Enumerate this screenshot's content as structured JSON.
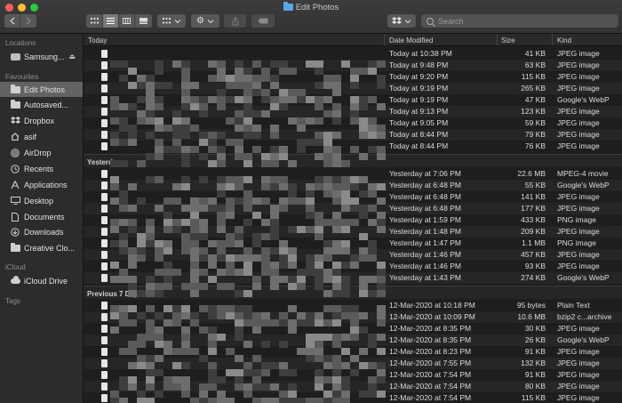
{
  "window": {
    "title": "Edit Photos"
  },
  "search": {
    "placeholder": "Search"
  },
  "sidebar": {
    "locations_title": "Locations",
    "locations": [
      {
        "label": "Samsung...",
        "icon": "disk-icon"
      }
    ],
    "favourites_title": "Favourites",
    "favourites": [
      {
        "label": "Edit Photos",
        "icon": "folder-icon",
        "selected": true
      },
      {
        "label": "Autosaved...",
        "icon": "folder-icon"
      },
      {
        "label": "Dropbox",
        "icon": "dropbox-icon"
      },
      {
        "label": "asif",
        "icon": "home-icon"
      },
      {
        "label": "AirDrop",
        "icon": "airdrop-icon"
      },
      {
        "label": "Recents",
        "icon": "clock-icon"
      },
      {
        "label": "Applications",
        "icon": "applications-icon"
      },
      {
        "label": "Desktop",
        "icon": "desktop-icon"
      },
      {
        "label": "Documents",
        "icon": "document-icon"
      },
      {
        "label": "Downloads",
        "icon": "download-icon"
      },
      {
        "label": "Creative Clo...",
        "icon": "folder-icon"
      }
    ],
    "icloud_title": "iCloud",
    "icloud": [
      {
        "label": "iCloud Drive",
        "icon": "cloud-icon"
      }
    ],
    "tags_title": "Tags"
  },
  "columns": {
    "name": "Today",
    "date": "Date Modified",
    "size": "Size",
    "kind": "Kind"
  },
  "groups": [
    {
      "title": "Today",
      "rows": [
        {
          "date": "Today at 10:38 PM",
          "size": "41 KB",
          "kind": "JPEG image"
        },
        {
          "date": "Today at 9:48 PM",
          "size": "63 KB",
          "kind": "JPEG image"
        },
        {
          "date": "Today at 9:20 PM",
          "size": "115 KB",
          "kind": "JPEG image"
        },
        {
          "date": "Today at 9:19 PM",
          "size": "265 KB",
          "kind": "JPEG image"
        },
        {
          "date": "Today at 9:19 PM",
          "size": "47 KB",
          "kind": "Google's WebP"
        },
        {
          "date": "Today at 9:13 PM",
          "size": "123 KB",
          "kind": "JPEG image"
        },
        {
          "date": "Today at 9:05 PM",
          "size": "59 KB",
          "kind": "JPEG image"
        },
        {
          "date": "Today at 8:44 PM",
          "size": "79 KB",
          "kind": "JPEG image"
        },
        {
          "date": "Today at 8:44 PM",
          "size": "76 KB",
          "kind": "JPEG image"
        }
      ]
    },
    {
      "title": "Yesterday",
      "rows": [
        {
          "date": "Yesterday at 7:06 PM",
          "size": "22.6 MB",
          "kind": "MPEG-4 movie"
        },
        {
          "date": "Yesterday at 6:48 PM",
          "size": "55 KB",
          "kind": "Google's WebP"
        },
        {
          "date": "Yesterday at 6:48 PM",
          "size": "141 KB",
          "kind": "JPEG image"
        },
        {
          "date": "Yesterday at 6:48 PM",
          "size": "177 KB",
          "kind": "JPEG image"
        },
        {
          "date": "Yesterday at 1:59 PM",
          "size": "433 KB",
          "kind": "PNG image"
        },
        {
          "date": "Yesterday at 1:48 PM",
          "size": "209 KB",
          "kind": "JPEG image"
        },
        {
          "date": "Yesterday at 1:47 PM",
          "size": "1.1 MB",
          "kind": "PNG image"
        },
        {
          "date": "Yesterday at 1:46 PM",
          "size": "457 KB",
          "kind": "JPEG image"
        },
        {
          "date": "Yesterday at 1:46 PM",
          "size": "93 KB",
          "kind": "JPEG image"
        },
        {
          "date": "Yesterday at 1:43 PM",
          "size": "274 KB",
          "kind": "Google's WebP"
        }
      ]
    },
    {
      "title": "Previous 7 Days",
      "rows": [
        {
          "date": "12-Mar-2020 at 10:18 PM",
          "size": "95 bytes",
          "kind": "Plain Text"
        },
        {
          "date": "12-Mar-2020 at 10:09 PM",
          "size": "10.6 MB",
          "kind": "bzip2 c...archive"
        },
        {
          "date": "12-Mar-2020 at 8:35 PM",
          "size": "30 KB",
          "kind": "JPEG image"
        },
        {
          "date": "12-Mar-2020 at 8:35 PM",
          "size": "26 KB",
          "kind": "Google's WebP"
        },
        {
          "date": "12-Mar-2020 at 8:23 PM",
          "size": "91 KB",
          "kind": "JPEG image"
        },
        {
          "date": "12-Mar-2020 at 7:55 PM",
          "size": "132 KB",
          "kind": "JPEG image"
        },
        {
          "date": "12-Mar-2020 at 7:54 PM",
          "size": "91 KB",
          "kind": "JPEG image"
        },
        {
          "date": "12-Mar-2020 at 7:54 PM",
          "size": "80 KB",
          "kind": "JPEG image"
        },
        {
          "date": "12-Mar-2020 at 7:54 PM",
          "size": "115 KB",
          "kind": "JPEG image"
        }
      ]
    }
  ],
  "colors": {
    "accent": "#5ba7e6",
    "close": "#fe5f57",
    "minimize": "#febc2e",
    "maximize": "#28c840"
  }
}
